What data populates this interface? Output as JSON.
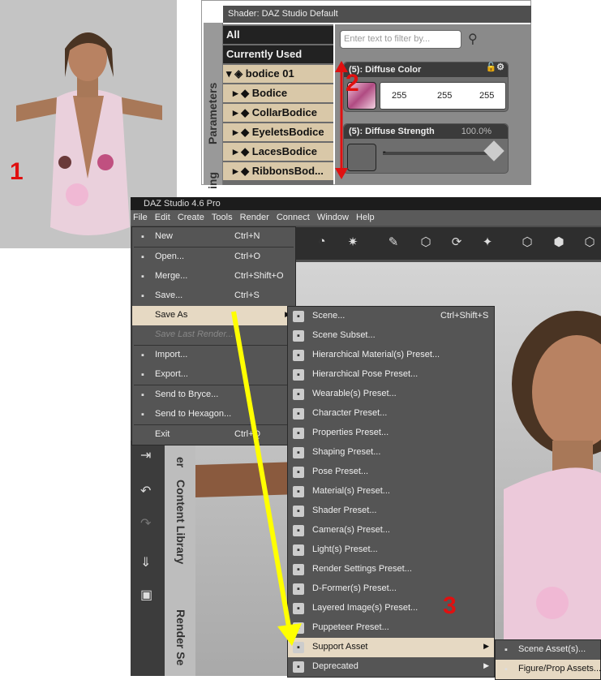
{
  "panel1": {
    "number": "1"
  },
  "panel2": {
    "number": "2",
    "header": "Shader: DAZ Studio Default",
    "side_tab_1": "Parameters",
    "side_tab_2": "ing",
    "tree": [
      {
        "label": "All",
        "style": "dark"
      },
      {
        "label": "Currently Used",
        "style": "dark"
      },
      {
        "label": "bodice 01",
        "style": "light",
        "expanded": true
      },
      {
        "label": "Bodice",
        "style": "light"
      },
      {
        "label": "CollarBodice",
        "style": "light"
      },
      {
        "label": "EyeletsBodice",
        "style": "light"
      },
      {
        "label": "LacesBodice",
        "style": "light"
      },
      {
        "label": "RibbonsBod...",
        "style": "light"
      }
    ],
    "filter_placeholder": "Enter text to filter by...",
    "diffuse_color": {
      "label": "(5): Diffuse Color",
      "r": "255",
      "g": "255",
      "b": "255"
    },
    "diffuse_strength": {
      "label": "(5): Diffuse Strength",
      "value": "100.0%",
      "slider_text": "-"
    }
  },
  "app": {
    "title": "DAZ Studio 4.6 Pro",
    "menu": [
      "File",
      "Edit",
      "Create",
      "Tools",
      "Render",
      "Connect",
      "Window",
      "Help"
    ],
    "side_tabs": [
      "er",
      "Content Library",
      "Render Se"
    ]
  },
  "file_menu": [
    {
      "label": "New",
      "shortcut": "Ctrl+N",
      "icon": "new-file-icon"
    },
    {
      "sep": true
    },
    {
      "label": "Open...",
      "shortcut": "Ctrl+O",
      "icon": "open-folder-icon"
    },
    {
      "label": "Merge...",
      "shortcut": "Ctrl+Shift+O",
      "icon": "merge-icon"
    },
    {
      "label": "Save...",
      "shortcut": "Ctrl+S",
      "icon": "save-icon"
    },
    {
      "label": "Save As",
      "shortcut": "",
      "submenu": true,
      "selected": true
    },
    {
      "label": "Save Last Render...",
      "shortcut": "",
      "disabled": true
    },
    {
      "sep": true
    },
    {
      "label": "Import...",
      "shortcut": "",
      "icon": "import-icon"
    },
    {
      "label": "Export...",
      "shortcut": "",
      "icon": "export-icon"
    },
    {
      "sep": true
    },
    {
      "label": "Send to Bryce...",
      "shortcut": "",
      "icon": "bryce-icon"
    },
    {
      "label": "Send to Hexagon...",
      "shortcut": "",
      "icon": "hexagon-icon"
    },
    {
      "sep": true
    },
    {
      "label": "Exit",
      "shortcut": "Ctrl+Q"
    }
  ],
  "saveas_menu": [
    {
      "label": "Scene...",
      "shortcut": "Ctrl+Shift+S"
    },
    {
      "label": "Scene Subset..."
    },
    {
      "label": "Hierarchical Material(s) Preset..."
    },
    {
      "label": "Hierarchical Pose Preset..."
    },
    {
      "label": "Wearable(s) Preset..."
    },
    {
      "label": "Character Preset..."
    },
    {
      "label": "Properties Preset..."
    },
    {
      "label": "Shaping Preset..."
    },
    {
      "label": "Pose Preset..."
    },
    {
      "label": "Material(s) Preset..."
    },
    {
      "label": "Shader Preset..."
    },
    {
      "label": "Camera(s) Preset..."
    },
    {
      "label": "Light(s) Preset..."
    },
    {
      "label": "Render Settings Preset..."
    },
    {
      "label": "D-Former(s) Preset..."
    },
    {
      "label": "Layered Image(s) Preset..."
    },
    {
      "label": "Puppeteer Preset..."
    },
    {
      "label": "Support Asset",
      "submenu": true,
      "selected": true
    },
    {
      "label": "Deprecated",
      "submenu": true
    }
  ],
  "support_menu": [
    {
      "label": "Scene Asset(s)..."
    },
    {
      "label": "Figure/Prop Assets...",
      "selected": true
    }
  ],
  "annotation": {
    "number": "3"
  }
}
